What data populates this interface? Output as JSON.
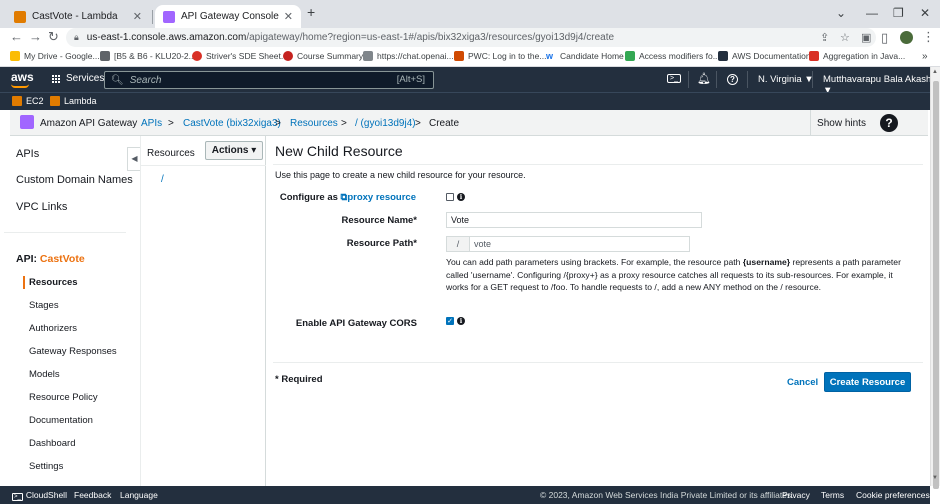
{
  "browser": {
    "tabs": [
      {
        "title": "CastVote - Lambda",
        "close": "✕"
      },
      {
        "title": "API Gateway Console",
        "close": "✕"
      }
    ],
    "new_tab": "+",
    "window_controls": {
      "minimize": "—",
      "restore": "❐",
      "close": "✕",
      "menu": "⌄"
    },
    "url_host": "us-east-1.console.aws.amazon.com",
    "url_path": "/apigateway/home?region=us-east-1#/apis/bix32xiga3/resources/gyoi13d9j4/create",
    "bookmarks": [
      "My Drive - Google...",
      "[B5 & B6 - KLU20-2...",
      "Striver's SDE Sheet...",
      "Course Summary",
      "https://chat.openai....",
      "PWC: Log in to the...",
      "Candidate Home",
      "Access modifiers fo...",
      "AWS Documentation",
      "Aggregation in Java..."
    ],
    "bookmarks_more": "»"
  },
  "aws_nav": {
    "logo": "aws",
    "services": "Services",
    "search_placeholder": "Search",
    "search_shortcut": "[Alt+S]",
    "region": "N. Virginia ▼",
    "user": "Mutthavarapu Bala Akash ▼",
    "favorites": [
      "EC2",
      "Lambda"
    ]
  },
  "breadcrumb": {
    "service": "Amazon API Gateway",
    "items": [
      "APIs",
      "CastVote (bix32xiga3)",
      "Resources",
      "/ (gyoi13d9j4)",
      "Create"
    ],
    "sep": ">",
    "show_hints": "Show hints",
    "help": "?"
  },
  "sidebar": {
    "top_links": [
      "APIs",
      "Custom Domain Names",
      "VPC Links"
    ],
    "api_prefix": "API:",
    "api_name": "CastVote",
    "items": [
      "Resources",
      "Stages",
      "Authorizers",
      "Gateway Responses",
      "Models",
      "Resource Policy",
      "Documentation",
      "Dashboard",
      "Settings"
    ],
    "active_item": "Resources",
    "collapse": "◀"
  },
  "resources_panel": {
    "title": "Resources",
    "actions": "Actions ▾",
    "tree": [
      "/"
    ]
  },
  "form": {
    "title": "New Child Resource",
    "description": "Use this page to create a new child resource for your resource.",
    "proxy_label_prefix": "Configure as",
    "proxy_link": "proxy resource",
    "proxy_checked": false,
    "resource_name_label": "Resource Name*",
    "resource_name_value": "Vote",
    "resource_path_label": "Resource Path*",
    "resource_path_prefix": "/",
    "resource_path_value": "vote",
    "help_part1": "You can add path parameters using brackets. For example, the resource path ",
    "help_bold": "{username}",
    "help_part2": " represents a path parameter called 'username'. Configuring /{proxy+} as a proxy resource catches all requests to its sub-resources. For example, it works for a GET request to /foo. To handle requests to /, add a new ANY method on the / resource.",
    "cors_label": "Enable API Gateway CORS",
    "cors_checked": true,
    "required_note": "* Required",
    "cancel": "Cancel",
    "create": "Create Resource"
  },
  "footer": {
    "cloudshell": "CloudShell",
    "feedback": "Feedback",
    "language": "Language",
    "copyright": "© 2023, Amazon Web Services India Private Limited or its affiliates.",
    "privacy": "Privacy",
    "terms": "Terms",
    "cookies": "Cookie preferences"
  },
  "colors": {
    "aws_nav_bg": "#232f3e",
    "accent_orange": "#ec7211",
    "link_blue": "#0073bb",
    "primary_button": "#0073bb"
  }
}
